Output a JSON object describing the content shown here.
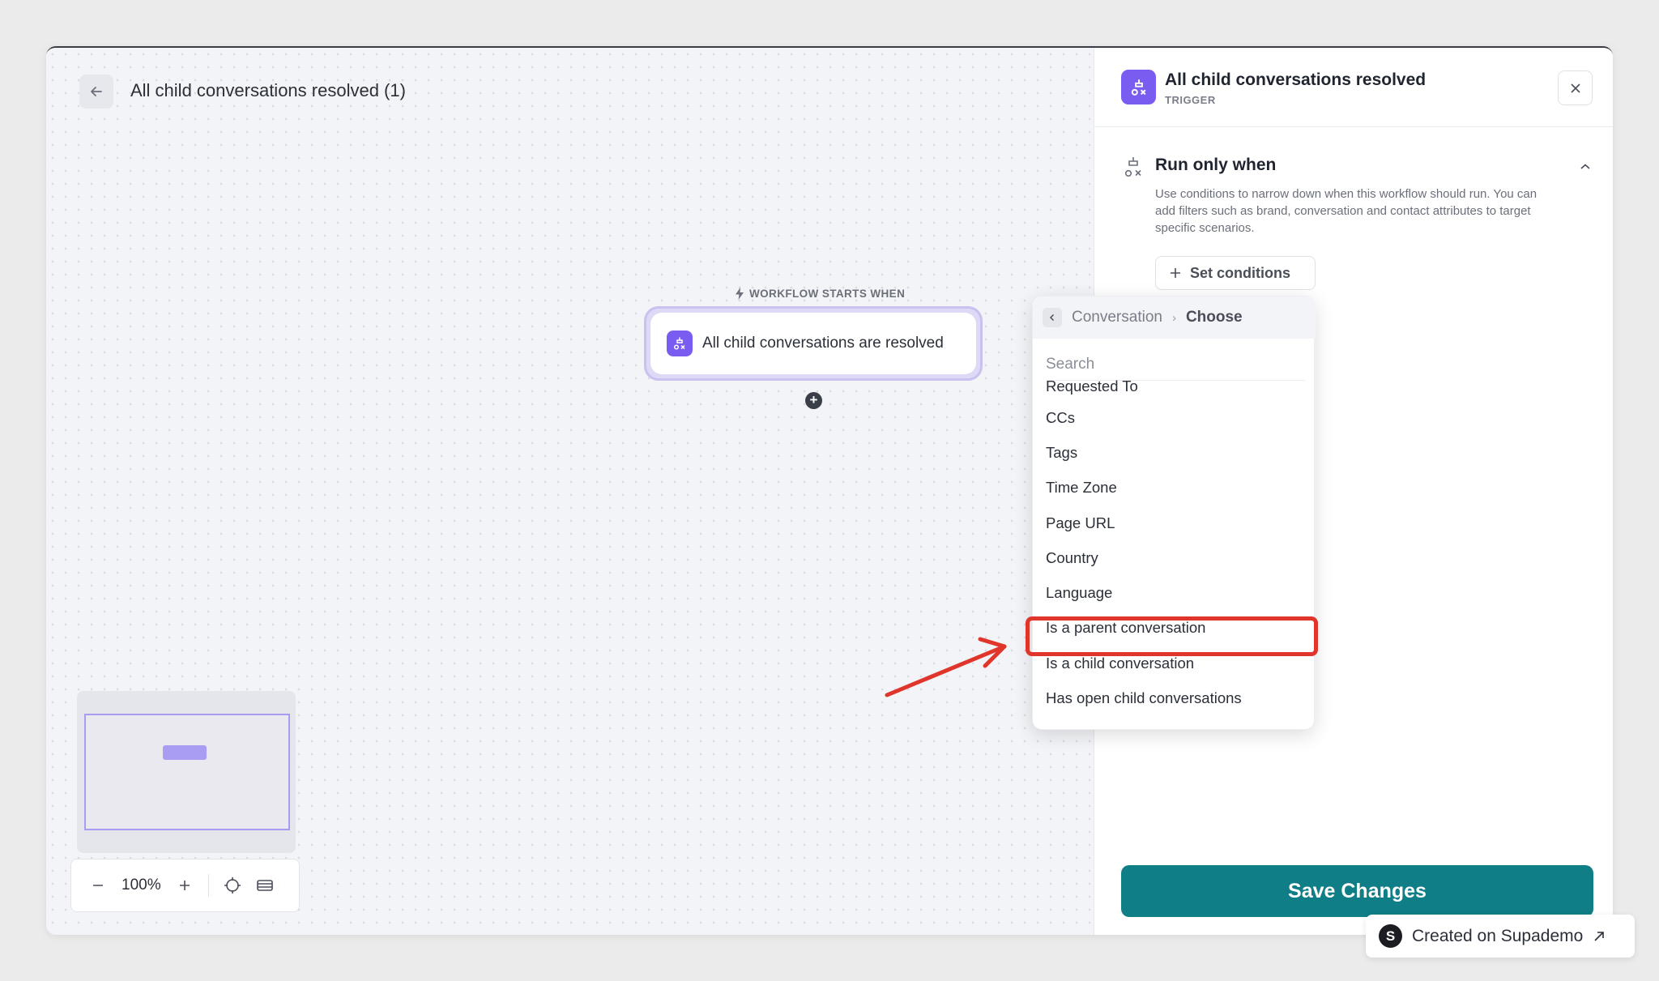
{
  "canvas": {
    "title": "All child conversations resolved (1)",
    "workflow_starts_label": "WORKFLOW STARTS WHEN",
    "trigger_node_label": "All child conversations are resolved",
    "add_node_symbol": "+",
    "zoom_level": "100%"
  },
  "panel": {
    "title": "All child conversations resolved",
    "subtitle": "TRIGGER",
    "run_only_when": "Run only when",
    "description": "Use conditions to narrow down when this workflow should run. You can add filters such as brand, conversation and contact attributes to target specific scenarios.",
    "set_conditions_label": "Set conditions",
    "save_label": "Save Changes"
  },
  "dropdown": {
    "breadcrumb_parent": "Conversation",
    "breadcrumb_separator": "›",
    "breadcrumb_current": "Choose",
    "search_placeholder": "Search",
    "items": [
      "Requested To",
      "CCs",
      "Tags",
      "Time Zone",
      "Page URL",
      "Country",
      "Language",
      "Is a parent conversation",
      "Is a child conversation",
      "Has open child conversations"
    ],
    "highlighted_item": "Is a parent conversation"
  },
  "badge": {
    "logo_letter": "S",
    "label": "Created on Supademo"
  },
  "colors": {
    "accent_purple": "#7b5cf0",
    "save_teal": "#0f7e86",
    "highlight_red": "#e0352b"
  }
}
